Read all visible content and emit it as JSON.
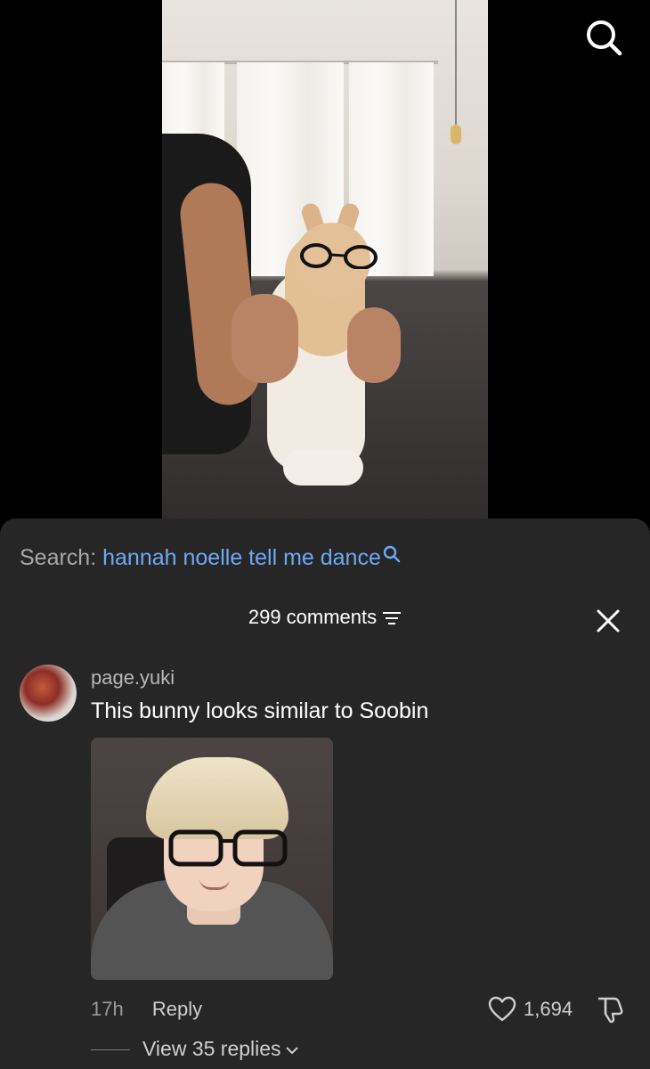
{
  "search": {
    "label": "Search:",
    "query": "hannah noelle tell me dance"
  },
  "comments_header": {
    "count_label": "299 comments"
  },
  "comment": {
    "username": "page.yuki",
    "text": "This bunny looks similar to Soobin",
    "time": "17h",
    "reply_label": "Reply",
    "likes": "1,694",
    "view_replies": "View 35 replies"
  },
  "icons": {
    "top_search": "search-icon",
    "close": "close-icon",
    "filter": "filter-icon",
    "like": "heart-icon",
    "dislike": "thumbs-down-icon",
    "chevron": "chevron-down-icon"
  },
  "colors": {
    "sheet_bg": "#262626",
    "search_query": "#6fa8f5",
    "muted_text": "#a8a8a8"
  }
}
